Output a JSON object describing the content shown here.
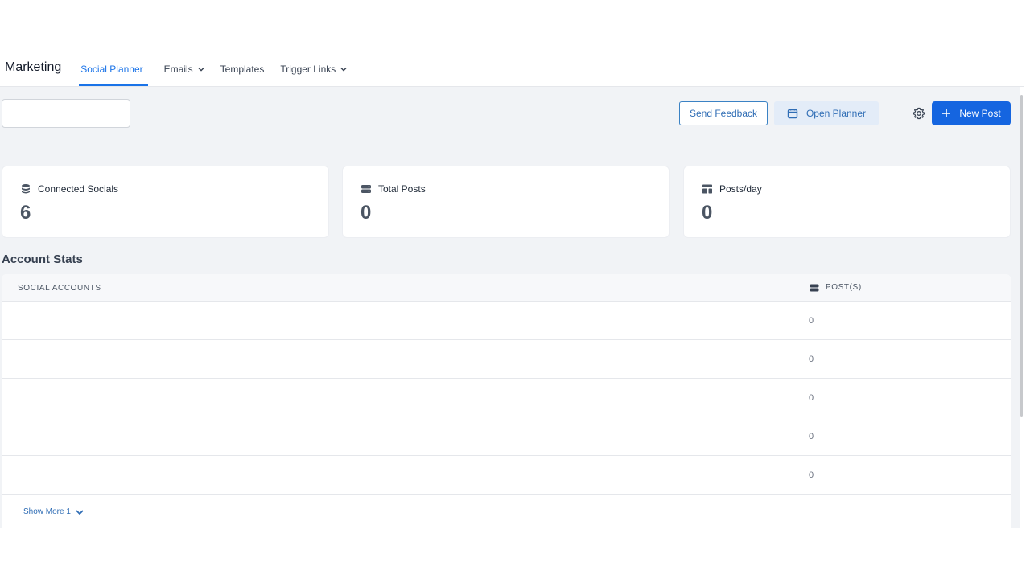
{
  "header": {
    "brand": "Marketing",
    "tabs": [
      {
        "label": "Social Planner",
        "active": true,
        "dropdown": false
      },
      {
        "label": "Emails",
        "active": false,
        "dropdown": true
      },
      {
        "label": "Templates",
        "active": false,
        "dropdown": false
      },
      {
        "label": "Trigger Links",
        "active": false,
        "dropdown": true
      }
    ]
  },
  "toolbar": {
    "search_value": "",
    "feedback_label": "Send Feedback",
    "planner_label": "Open Planner",
    "new_post_label": "New Post"
  },
  "stats": [
    {
      "label": "Connected Socials",
      "value": "6",
      "icon": "database-icon"
    },
    {
      "label": "Total Posts",
      "value": "0",
      "icon": "server-icon"
    },
    {
      "label": "Posts/day",
      "value": "0",
      "icon": "layout-icon"
    }
  ],
  "account_stats": {
    "title": "Account Stats",
    "columns": {
      "accounts": "SOCIAL ACCOUNTS",
      "posts": "POST(S)"
    },
    "rows": [
      {
        "account": "",
        "posts": "0"
      },
      {
        "account": "",
        "posts": "0"
      },
      {
        "account": "",
        "posts": "0"
      },
      {
        "account": "",
        "posts": "0"
      },
      {
        "account": "",
        "posts": "0"
      }
    ],
    "show_more_label": "Show More 1"
  },
  "colors": {
    "accent": "#1a73e8",
    "primary_button": "#1565e0",
    "background": "#f1f3f6"
  }
}
